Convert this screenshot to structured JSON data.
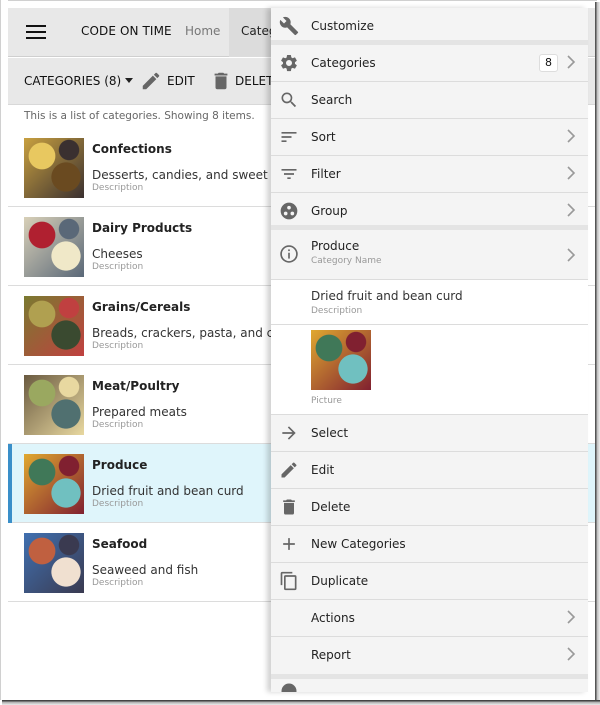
{
  "topbar": {
    "menu_icon": "hamburger-icon",
    "brand": "CODE ON TIME",
    "nav": [
      "Home",
      "Categories"
    ]
  },
  "toolbar": {
    "view_selector": "CATEGORIES (8)",
    "edit_label": "EDIT",
    "delete_label": "DELETE"
  },
  "summary": "This is a list of categories. Showing 8 items.",
  "list": {
    "selected_index": 4,
    "items": [
      {
        "name": "Confections",
        "description": "Desserts, candies, and sweet breads",
        "description_label": "Description",
        "picture_colors": [
          "#c8a040",
          "#e8c860",
          "#6a4a20",
          "#3a3030"
        ]
      },
      {
        "name": "Dairy Products",
        "description": "Cheeses",
        "description_label": "Description",
        "picture_colors": [
          "#d8d0b8",
          "#b02030",
          "#f0e8c8",
          "#5a6878"
        ]
      },
      {
        "name": "Grains/Cereals",
        "description": "Breads, crackers, pasta, and cereal",
        "description_label": "Description",
        "picture_colors": [
          "#7a7a30",
          "#b0a050",
          "#3a4a30",
          "#c04040"
        ]
      },
      {
        "name": "Meat/Poultry",
        "description": "Prepared meats",
        "description_label": "Description",
        "picture_colors": [
          "#6a5a40",
          "#9aa860",
          "#507070",
          "#e8d8a0"
        ]
      },
      {
        "name": "Produce",
        "description": "Dried fruit and bean curd",
        "description_label": "Description",
        "picture_colors": [
          "#e0a830",
          "#407858",
          "#70c0c0",
          "#802030"
        ]
      },
      {
        "name": "Seafood",
        "description": "Seaweed and fish",
        "description_label": "Description",
        "picture_colors": [
          "#4070b0",
          "#c06040",
          "#f0e0d0",
          "#3a3a50"
        ]
      }
    ]
  },
  "panel": {
    "customize": {
      "label": "Customize",
      "icon": "wrench-icon"
    },
    "categories": {
      "label": "Categories",
      "count": "8",
      "icon": "gear-icon"
    },
    "search": {
      "label": "Search",
      "icon": "search-icon"
    },
    "sort": {
      "label": "Sort",
      "icon": "sort-icon"
    },
    "filter": {
      "label": "Filter",
      "icon": "filter-icon"
    },
    "group": {
      "label": "Group",
      "icon": "group-icon"
    },
    "record": {
      "label": "Produce",
      "sublabel": "Category Name",
      "icon": "info-icon"
    },
    "description_field": {
      "value": "Dried fruit and bean curd",
      "label": "Description"
    },
    "picture_field": {
      "label": "Picture"
    },
    "select": {
      "label": "Select",
      "icon": "arrow-right-icon"
    },
    "edit": {
      "label": "Edit",
      "icon": "pencil-icon"
    },
    "delete": {
      "label": "Delete",
      "icon": "trash-icon"
    },
    "new": {
      "label": "New Categories",
      "icon": "plus-icon"
    },
    "duplicate": {
      "label": "Duplicate",
      "icon": "copy-icon"
    },
    "actions": {
      "label": "Actions"
    },
    "report": {
      "label": "Report"
    }
  },
  "colors": {
    "selected_row_bg": "#dff5fb",
    "selected_row_accent": "#3a8fc9",
    "icon_gray": "#666666",
    "panel_bg": "#f4f4f4"
  }
}
